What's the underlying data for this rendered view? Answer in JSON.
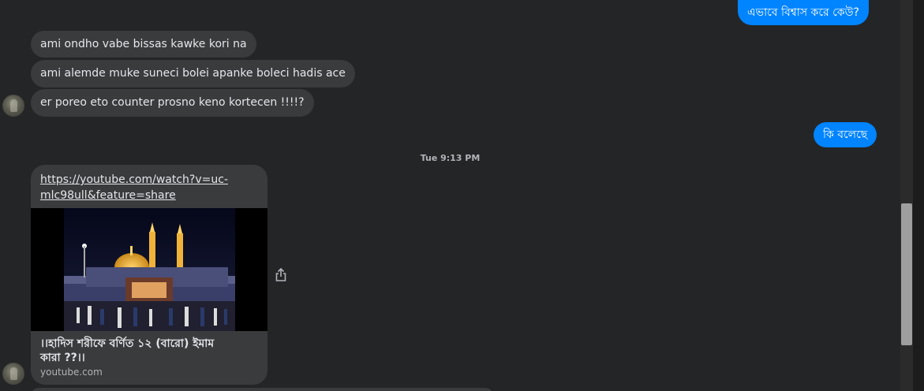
{
  "messages": {
    "sent_top": "এভাবে বিশ্বাস করে কেউ?",
    "recv_1": "ami ondho vabe bissas kawke kori na",
    "recv_2": "ami alemde muke suneci bolei apanke boleci hadis ace",
    "recv_3": "er poreo eto counter prosno keno kortecen !!!!?",
    "sent_2": "কি বলেছে"
  },
  "timestamp": "Tue 9:13 PM",
  "link_card": {
    "url_line1": "https://youtube.com/watch?v=uc-",
    "url_line2": "mlc98ull&feature=share",
    "title_line1": "।।হাদিস শরীফে বর্ণিত ১২ (বারো) ইমাম",
    "title_line2": "কারা ??।।",
    "domain": "youtube.com",
    "thumbnail_icon": "shrine-at-night-image"
  },
  "icons": {
    "share": "share-icon",
    "avatar": "contact-avatar"
  },
  "colors": {
    "background": "#242526",
    "received_bubble": "#3a3b3c",
    "sent_bubble": "#0084ff",
    "text_light": "#e4e6eb",
    "text_muted": "#b0b3b8"
  }
}
